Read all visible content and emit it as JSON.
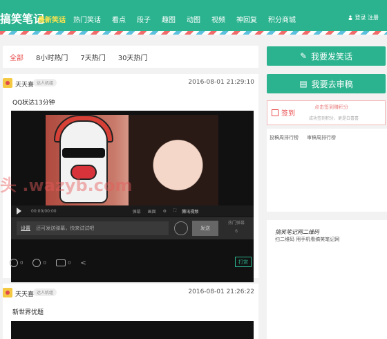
{
  "header": {
    "logo": "搞笑笔记",
    "logo_sub": "最新笑话",
    "nav": [
      "热门笑话",
      "看点",
      "段子",
      "趣图",
      "动图",
      "视频",
      "神回复",
      "积分商城"
    ],
    "login": "登录 注册"
  },
  "tabs": [
    "全部",
    "8小时热门",
    "7天热门",
    "30天热门"
  ],
  "active_tab": "全部",
  "posts": [
    {
      "user": "天天喜",
      "badge": "达人机组",
      "time": "2016-08-01 21:29:10",
      "title": "QQ状达13分钟",
      "video": {
        "time": "00:00/00:00",
        "controls": [
          "弹幕",
          "画面",
          "播放视频"
        ],
        "brand": "腾讯视频",
        "danmaku_setting": "设置",
        "danmaku_placeholder": "还可发送弹幕，快来试试吧",
        "send_label": "发送",
        "hot_label": "热门弹幕",
        "hot_count": "6"
      },
      "likes": "0",
      "dislikes": "0",
      "comments": "0",
      "reward": "打赏"
    },
    {
      "user": "天天喜",
      "badge": "达人机组",
      "time": "2016-08-01 21:26:22",
      "title": "新世界优题"
    }
  ],
  "sidebar": {
    "post_joke": "我要发笑话",
    "review": "我要去审稿",
    "signin": "签到",
    "signin_line1": "点击签到赚积分",
    "signin_line2": "成功签到积分，更是白喜喜",
    "rank_tabs": [
      "投稿周排行榜",
      "审稿周排行榜"
    ],
    "qr_title": "搞笑笔记网二维码",
    "qr_desc": "扫二维码 用手机看搞笑笔记网"
  },
  "watermark": "头 .wazyb.com",
  "colors": {
    "brand": "#2bb38f",
    "accent": "#e84c4c",
    "logo_sub": "#ffe34d"
  }
}
